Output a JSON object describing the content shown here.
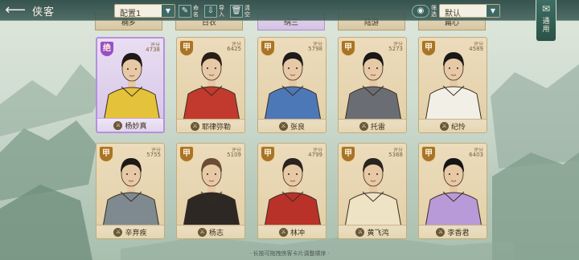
{
  "header": {
    "back_icon": "back-arrow-icon",
    "title": "侠客",
    "preset_select": "配置1",
    "tools": [
      {
        "icon": "brush-icon",
        "label": "命名"
      },
      {
        "icon": "export-icon",
        "label": "导入"
      },
      {
        "icon": "trash-icon",
        "label": "清空"
      }
    ],
    "filter_label": "筛选",
    "filter_icon": "eye-icon",
    "sort_select": "默认",
    "side_tab_label": "通用",
    "side_tab_icon": "scroll-icon"
  },
  "top_row": [
    {
      "name": "楠乡",
      "style": "gold"
    },
    {
      "name": "日衣",
      "style": "gold"
    },
    {
      "name": "纳三",
      "style": "purple"
    },
    {
      "name": "陆游",
      "style": "gold"
    },
    {
      "name": "扁心",
      "style": "gold"
    }
  ],
  "cards": [
    {
      "name": "杨妙真",
      "grade": "绝",
      "power": "4738",
      "style": "purple",
      "robe": "#e4c23a",
      "hair": "#1e1a18"
    },
    {
      "name": "耶律弥勒",
      "grade": "甲",
      "power": "6425",
      "style": "gold",
      "robe": "#c23a2e",
      "hair": "#2a1e18"
    },
    {
      "name": "张良",
      "grade": "甲",
      "power": "5798",
      "style": "gold",
      "robe": "#4d78b8",
      "hair": "#1c1a1a"
    },
    {
      "name": "托雷",
      "grade": "甲",
      "power": "5273",
      "style": "gold",
      "robe": "#6a6e74",
      "hair": "#1a1816"
    },
    {
      "name": "纪怜",
      "grade": "甲",
      "power": "4589",
      "style": "gold",
      "robe": "#f2efe6",
      "hair": "#1a1818"
    },
    {
      "name": "辛弃疾",
      "grade": "甲",
      "power": "5755",
      "style": "gold",
      "robe": "#7e8a90",
      "hair": "#1d1a18"
    },
    {
      "name": "杨志",
      "grade": "甲",
      "power": "5109",
      "style": "gold",
      "robe": "#2e2824",
      "hair": "#6a4c34"
    },
    {
      "name": "林冲",
      "grade": "甲",
      "power": "4799",
      "style": "gold",
      "robe": "#b8322a",
      "hair": "#2a2420"
    },
    {
      "name": "黄飞鸿",
      "grade": "甲",
      "power": "5368",
      "style": "gold",
      "robe": "#efe3c6",
      "hair": "#2a2420"
    },
    {
      "name": "李香君",
      "grade": "甲",
      "power": "6403",
      "style": "gold",
      "robe": "#b89ad8",
      "hair": "#161416"
    }
  ],
  "power_label": "评分",
  "footer_tip": "· 长按可拖拽侠客卡片调整顺序 ·",
  "colors": {
    "accent": "#3d6e63",
    "gold_card": "#e2cfa6",
    "purple_card": "#d5c4e6"
  }
}
